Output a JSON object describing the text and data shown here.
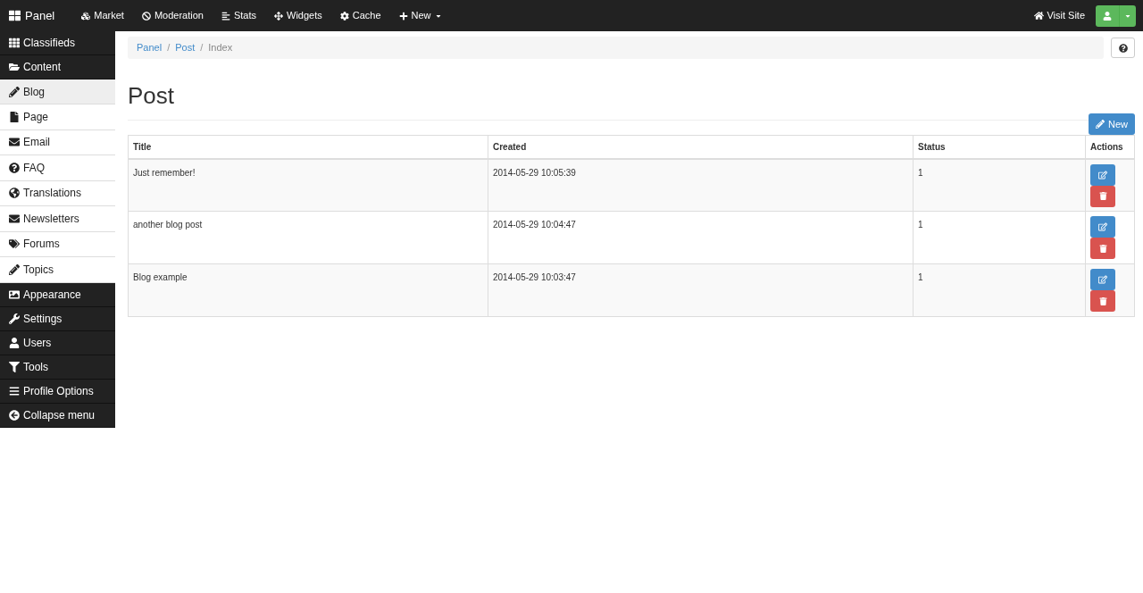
{
  "navbar": {
    "brand": "Panel",
    "items": [
      {
        "label": "Market"
      },
      {
        "label": "Moderation"
      },
      {
        "label": "Stats"
      },
      {
        "label": "Widgets"
      },
      {
        "label": "Cache"
      },
      {
        "label": "New",
        "dropdown": true
      }
    ],
    "visit_site": "Visit Site"
  },
  "sidebar": {
    "items": [
      {
        "label": "Classifieds",
        "kind": "section",
        "selected": false
      },
      {
        "label": "Content",
        "kind": "section",
        "selected": false
      },
      {
        "label": "Blog",
        "kind": "item",
        "selected": true
      },
      {
        "label": "Page",
        "kind": "item",
        "selected": false
      },
      {
        "label": "Email",
        "kind": "item",
        "selected": false
      },
      {
        "label": "FAQ",
        "kind": "item",
        "selected": false
      },
      {
        "label": "Translations",
        "kind": "item",
        "selected": false
      },
      {
        "label": "Newsletters",
        "kind": "item",
        "selected": false
      },
      {
        "label": "Forums",
        "kind": "item",
        "selected": false
      },
      {
        "label": "Topics",
        "kind": "item",
        "selected": false
      },
      {
        "label": "Appearance",
        "kind": "section",
        "selected": false
      },
      {
        "label": "Settings",
        "kind": "section",
        "selected": false
      },
      {
        "label": "Users",
        "kind": "section",
        "selected": false
      },
      {
        "label": "Tools",
        "kind": "section",
        "selected": false
      },
      {
        "label": "Profile Options",
        "kind": "section",
        "selected": false
      },
      {
        "label": "Collapse menu",
        "kind": "section",
        "selected": false
      }
    ]
  },
  "breadcrumb": {
    "separator": "/",
    "items": [
      {
        "label": "Panel",
        "link": true
      },
      {
        "label": "Post",
        "link": true
      },
      {
        "label": "Index",
        "link": false
      }
    ]
  },
  "page_title": "Post",
  "new_button": "New",
  "table": {
    "columns": [
      "Title",
      "Created",
      "Status",
      "Actions"
    ],
    "rows": [
      {
        "title": "Just remember!",
        "created": "2014-05-29 10:05:39",
        "status": "1"
      },
      {
        "title": "another blog post",
        "created": "2014-05-29 10:04:47",
        "status": "1"
      },
      {
        "title": "Blog example",
        "created": "2014-05-29 10:03:47",
        "status": "1"
      }
    ]
  }
}
